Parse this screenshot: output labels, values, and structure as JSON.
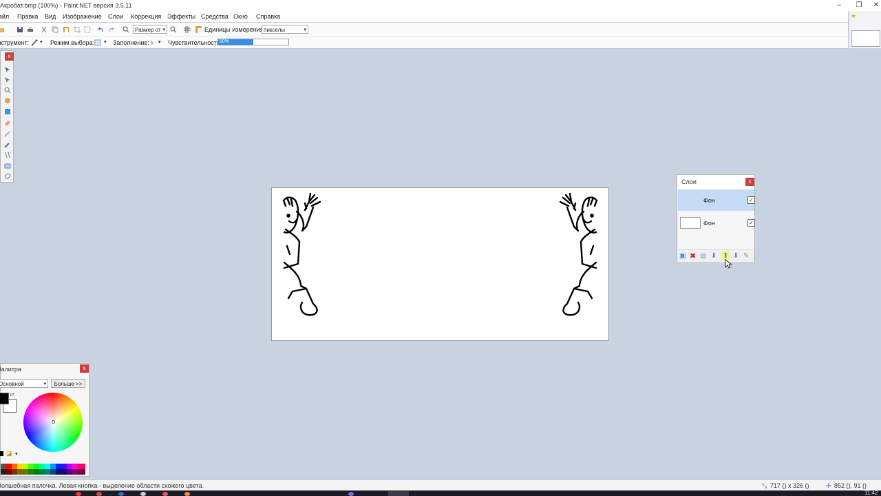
{
  "window": {
    "title": "Акробат.bmp (100%) - Paint.NET версия 3.5.11"
  },
  "menu": [
    "Файл",
    "Правка",
    "Вид",
    "Изображение",
    "Слои",
    "Коррекция",
    "Эффекты",
    "Средства",
    "Окно",
    "Справка"
  ],
  "toolbar": {
    "zoom_value": "Размер от",
    "units_label": "Единицы измерения:",
    "units_value": "пикселы"
  },
  "toolbar2": {
    "tool_label": "Инструмент:",
    "selmode_label": "Режим выбора:",
    "fill_label": "Заполнение:",
    "tolerance_label": "Чувствительность:",
    "tolerance_value": "50%",
    "tolerance_fraction": 0.5
  },
  "layers": {
    "title": "Слои",
    "close": "x",
    "items": [
      {
        "name": "Фон",
        "checked": true
      },
      {
        "name": "Фон",
        "checked": true
      }
    ]
  },
  "palette": {
    "title": "Палитра",
    "close": "x",
    "mode": "Основной",
    "more": "Больше >>"
  },
  "tools": {
    "close": "x"
  },
  "status": {
    "hint": "Волшебная палочка. Левая кнопка - выделение области схожего цвета.",
    "size": "717 () x 326 ()",
    "cursor": "852 (), 91 ()"
  },
  "taskbar": {
    "clock": "11:42"
  }
}
